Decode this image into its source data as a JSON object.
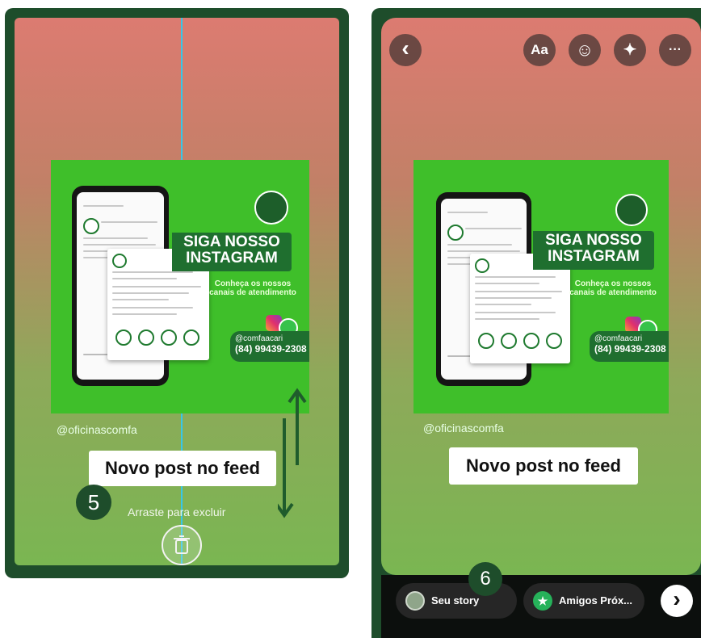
{
  "left": {
    "step_number": "5",
    "post": {
      "title_line1": "SIGA NOSSO",
      "title_line2": "INSTAGRAM",
      "subtitle_line1": "Conheça os nossos",
      "subtitle_line2": "canais de atendimento",
      "contact_handle": "@comfaacari",
      "contact_phone": "(84) 99439-2308"
    },
    "mention": "@oficinascomfa",
    "sticker_text": "Novo post no feed",
    "delete_hint": "Arraste para excluir"
  },
  "right": {
    "step_number": "6",
    "post": {
      "title_line1": "SIGA NOSSO",
      "title_line2": "INSTAGRAM",
      "subtitle_line1": "Conheça os nossos",
      "subtitle_line2": "canais de atendimento",
      "contact_handle": "@comfaacari",
      "contact_phone": "(84) 99439-2308"
    },
    "mention": "@oficinascomfa",
    "sticker_text": "Novo post no feed",
    "toolbar": {
      "back": "‹",
      "text_tool": "Aa",
      "sticker_tool": "☺",
      "effects_tool": "✦",
      "more": "···"
    },
    "share": {
      "your_story": "Seu story",
      "close_friends": "Amigos Próx...",
      "next": "›"
    }
  },
  "colors": {
    "frame": "#1e4d2b",
    "post_green": "#3fbf2a",
    "gradient_top": "#dc7b71",
    "gradient_bottom": "#7ab652",
    "guide_line": "#37c7e8"
  },
  "icons": [
    "back-arrow-icon",
    "text-icon",
    "sticker-icon",
    "effects-sparkle-icon",
    "more-dots-icon",
    "trash-icon",
    "drag-arrows-icon",
    "story-avatar-icon",
    "close-friends-star-icon",
    "chevron-right-icon",
    "instagram-icon",
    "whatsapp-icon"
  ]
}
